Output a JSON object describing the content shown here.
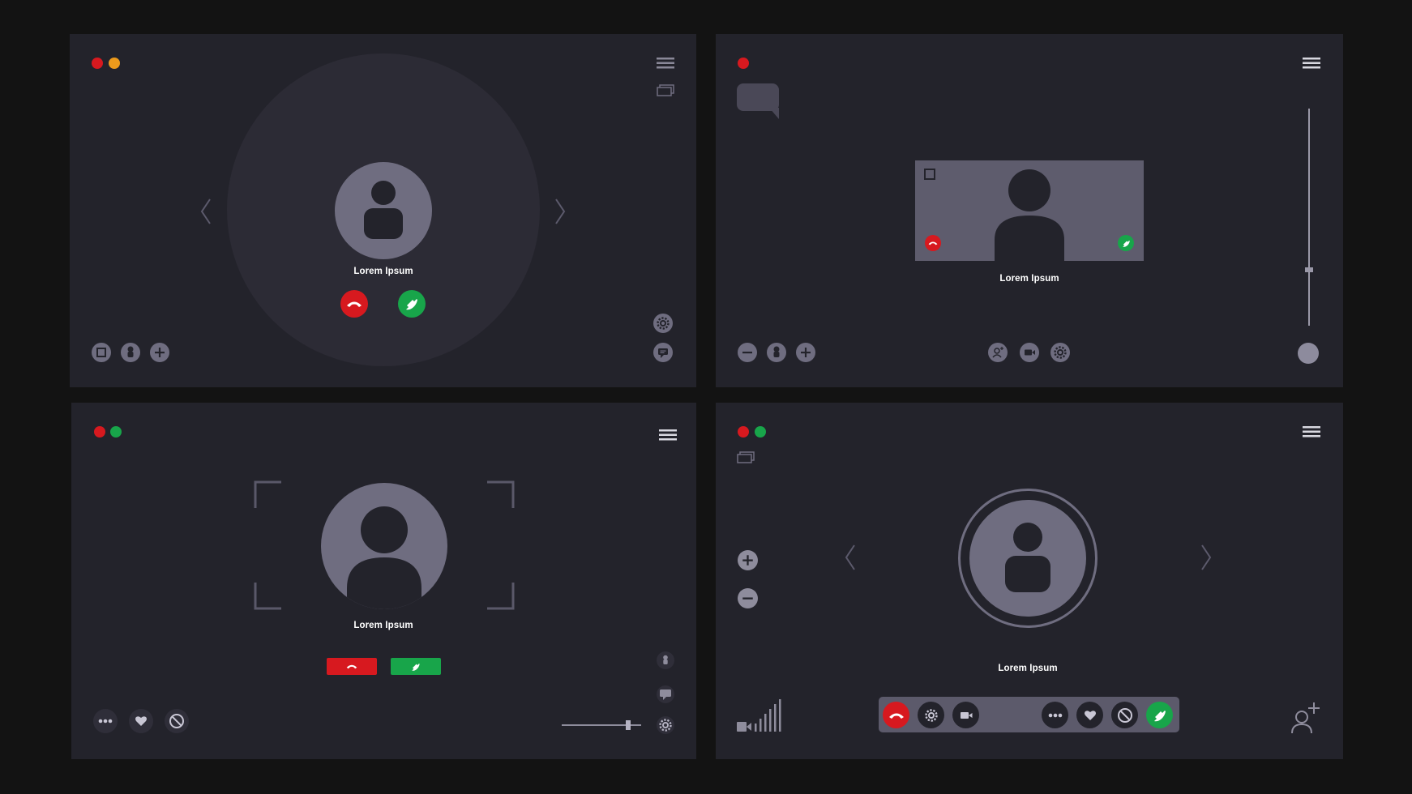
{
  "calls": [
    {
      "caller_name": "Lorem Ipsum"
    },
    {
      "caller_name": "Lorem Ipsum"
    },
    {
      "caller_name": "Lorem Ipsum"
    },
    {
      "caller_name": "Lorem Ipsum"
    }
  ],
  "colors": {
    "background": "#131313",
    "panel": "#23232b",
    "accent_gray": "#6f6d80",
    "decline": "#d7191f",
    "accept": "#18a54a",
    "minimize": "#ec9a1c"
  }
}
